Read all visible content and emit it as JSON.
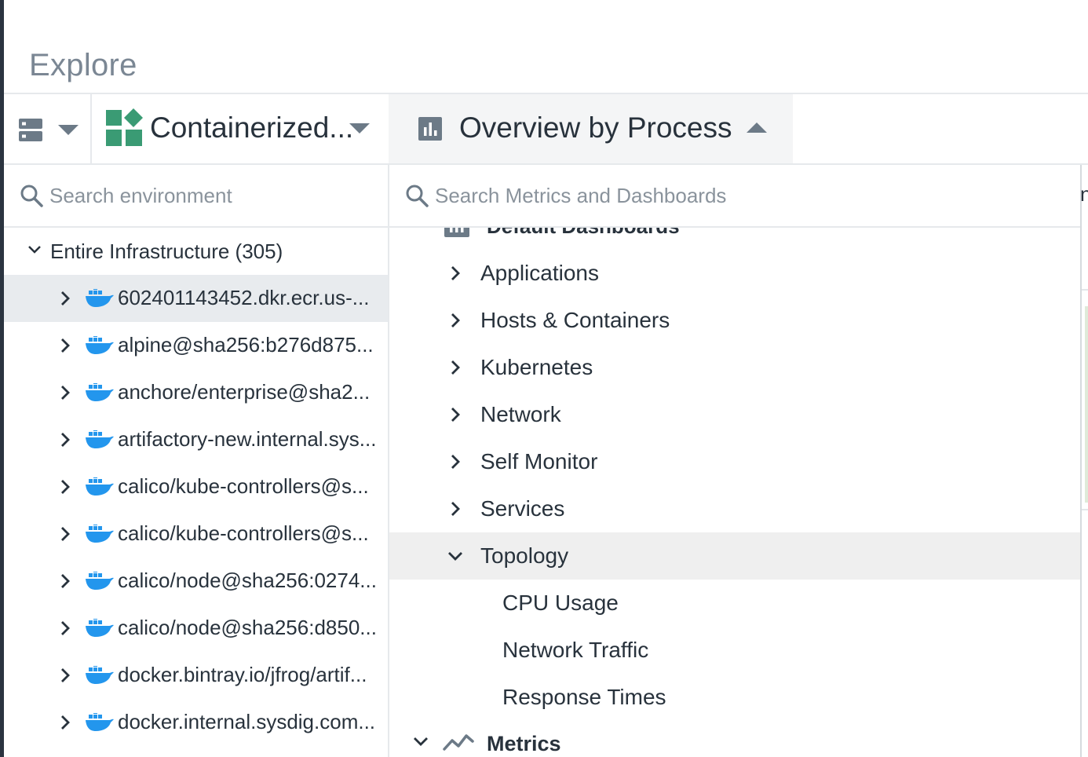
{
  "page": {
    "title": "Explore"
  },
  "toolbar": {
    "view_icon": "server-icon",
    "scope_label": "Containerized...",
    "scope_icon": "container-group-icon",
    "dashboard_icon": "bar-chart-icon",
    "dashboard_label": "Overview by Process"
  },
  "environment": {
    "search_placeholder": "Search environment",
    "root_label": "Entire Infrastructure (305)",
    "items": [
      {
        "label": "602401143452.dkr.ecr.us-...",
        "icon": "docker-icon",
        "selected": true
      },
      {
        "label": "alpine@sha256:b276d875...",
        "icon": "docker-icon"
      },
      {
        "label": "anchore/enterprise@sha2...",
        "icon": "docker-icon"
      },
      {
        "label": "artifactory-new.internal.sys...",
        "icon": "docker-icon"
      },
      {
        "label": "calico/kube-controllers@s...",
        "icon": "docker-icon"
      },
      {
        "label": "calico/kube-controllers@s...",
        "icon": "docker-icon"
      },
      {
        "label": "calico/node@sha256:0274...",
        "icon": "docker-icon"
      },
      {
        "label": "calico/node@sha256:d850...",
        "icon": "docker-icon"
      },
      {
        "label": "docker.bintray.io/jfrog/artif...",
        "icon": "docker-icon"
      },
      {
        "label": "docker.internal.sysdig.com...",
        "icon": "docker-icon"
      }
    ]
  },
  "dashboards": {
    "search_placeholder": "Search Metrics and Dashboards",
    "group_label": "Default Dashboards",
    "categories": [
      {
        "label": "Applications"
      },
      {
        "label": "Hosts & Containers"
      },
      {
        "label": "Kubernetes"
      },
      {
        "label": "Network"
      },
      {
        "label": "Self Monitor"
      },
      {
        "label": "Services"
      },
      {
        "label": "Topology",
        "expanded": true,
        "selected": true
      }
    ],
    "topology_items": [
      {
        "label": "CPU Usage"
      },
      {
        "label": "Network Traffic"
      },
      {
        "label": "Response Times"
      }
    ],
    "metrics_label": "Metrics",
    "metrics_icon": "line-chart-icon"
  },
  "background": {
    "partial_glyph": "n"
  },
  "colors": {
    "text": "#28323c",
    "muted": "#7b8794",
    "scope_green": "#3a9b74",
    "docker_blue": "#2396ed",
    "selected_row": "#e8ebee"
  }
}
